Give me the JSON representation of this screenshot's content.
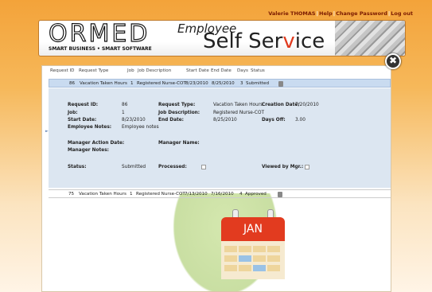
{
  "user": {
    "name": "Valerie THOMAS",
    "help": "Help",
    "change_password": "Change Password",
    "logout": "Log out"
  },
  "brand": {
    "name": "ORMED",
    "tagline": "SMART BUSINESS • SMART SOFTWARE"
  },
  "app_title": {
    "line1": "Employee",
    "line2_pre": "Self Ser",
    "line2_accent": "v",
    "line2_post": "ice"
  },
  "close_label": "✖",
  "columns": [
    "Request ID",
    "Request Type",
    "Job",
    "Job Description",
    "Start Date",
    "End Date",
    "Days",
    "Status"
  ],
  "rows": [
    {
      "id": "86",
      "type": "Vacation Taken Hours",
      "job": "1",
      "desc": "Registered Nurse-COT",
      "start": "8/23/2010",
      "end": "8/25/2010",
      "days": "3",
      "status": "Submitted"
    },
    {
      "id": "75",
      "type": "Vacation Taken Hours",
      "job": "1",
      "desc": "Registered Nurse-COT",
      "start": "7/13/2010",
      "end": "7/16/2010",
      "days": "4",
      "status": "Approved"
    }
  ],
  "detail": {
    "request_id_label": "Request ID:",
    "request_id": "86",
    "request_type_label": "Request Type:",
    "request_type": "Vacation Taken Hours",
    "creation_date_label": "Creation Date:",
    "creation_date": "7/20/2010",
    "job_label": "Job:",
    "job": "1",
    "job_desc_label": "Job Description:",
    "job_desc": "Registered Nurse-COT",
    "start_date_label": "Start Date:",
    "start_date": "8/23/2010",
    "end_date_label": "End Date:",
    "end_date": "8/25/2010",
    "days_off_label": "Days Off:",
    "days_off": "3.00",
    "employee_notes_label": "Employee Notes:",
    "employee_notes": "Employee notes",
    "manager_action_date_label": "Manager Action Date:",
    "manager_name_label": "Manager Name:",
    "manager_notes_label": "Manager Notes:",
    "status_label": "Status:",
    "status": "Submitted",
    "processed_label": "Processed:",
    "viewed_label": "Viewed by Mgr.:"
  },
  "calendar_month": "JAN",
  "colors": {
    "accent": "#e03a1e",
    "selected_row": "#c9dbf0",
    "detail_bg": "#dce6f1"
  }
}
